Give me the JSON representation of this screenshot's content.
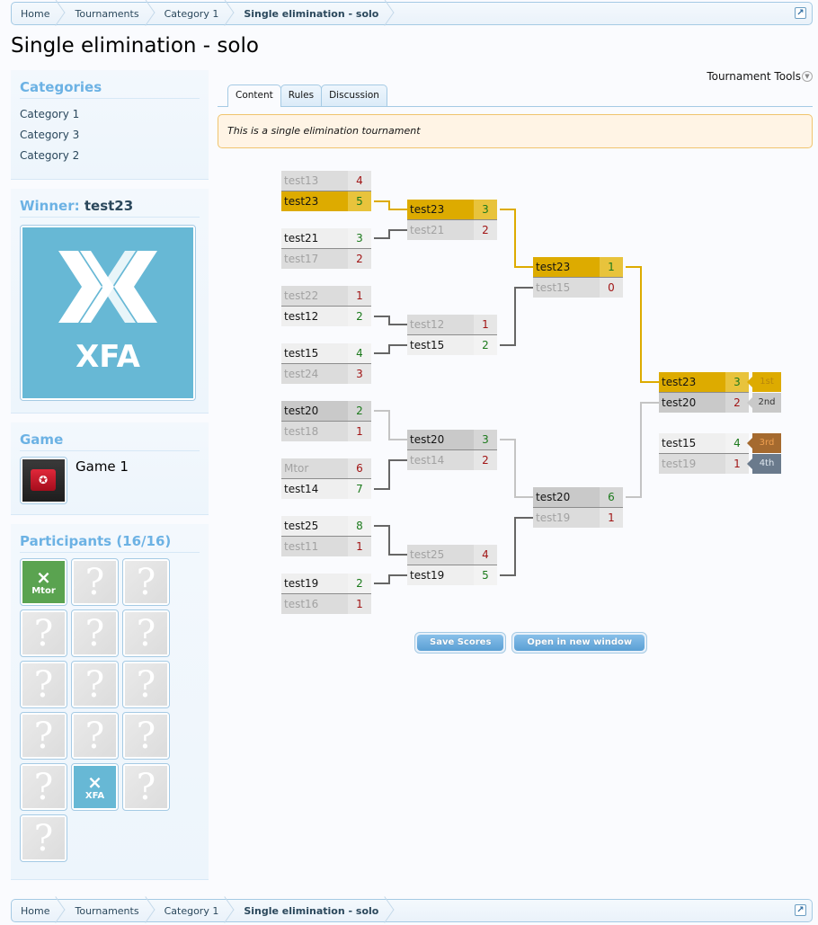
{
  "breadcrumb": {
    "items": [
      "Home",
      "Tournaments",
      "Category 1",
      "Single elimination - solo"
    ],
    "jump_icon": "arrow-up-right-icon"
  },
  "page": {
    "title": "Single elimination - solo"
  },
  "sidebar": {
    "categories": {
      "heading": "Categories",
      "items": [
        "Category 1",
        "Category 3",
        "Category 2"
      ]
    },
    "winner": {
      "label": "Winner:",
      "name": "test23",
      "logo_text": "XFA"
    },
    "game": {
      "heading": "Game",
      "name": "Game 1"
    },
    "participants": {
      "heading": "Participants (16/16)",
      "items": [
        {
          "label": "Mtor",
          "type": "team-green"
        },
        {
          "label": "",
          "type": "unknown"
        },
        {
          "label": "",
          "type": "unknown"
        },
        {
          "label": "",
          "type": "unknown"
        },
        {
          "label": "",
          "type": "unknown"
        },
        {
          "label": "",
          "type": "unknown"
        },
        {
          "label": "",
          "type": "unknown"
        },
        {
          "label": "",
          "type": "unknown"
        },
        {
          "label": "",
          "type": "unknown"
        },
        {
          "label": "",
          "type": "unknown"
        },
        {
          "label": "",
          "type": "unknown"
        },
        {
          "label": "",
          "type": "unknown"
        },
        {
          "label": "",
          "type": "unknown"
        },
        {
          "label": "XFA",
          "type": "team-blue"
        },
        {
          "label": "",
          "type": "unknown"
        },
        {
          "label": "",
          "type": "unknown"
        }
      ]
    }
  },
  "main": {
    "tools_label": "Tournament Tools",
    "tabs": [
      {
        "label": "Content",
        "active": true
      },
      {
        "label": "Rules",
        "active": false
      },
      {
        "label": "Discussion",
        "active": false
      }
    ],
    "description": "This is a single elimination tournament",
    "buttons": {
      "save": "Save Scores",
      "open": "Open in new window"
    }
  },
  "bracket": {
    "rounds": [
      [
        {
          "p1": {
            "name": "test13",
            "score": "4"
          },
          "p2": {
            "name": "test23",
            "score": "5"
          },
          "winner": 2
        },
        {
          "p1": {
            "name": "test21",
            "score": "3"
          },
          "p2": {
            "name": "test17",
            "score": "2"
          },
          "winner": 1
        },
        {
          "p1": {
            "name": "test22",
            "score": "1"
          },
          "p2": {
            "name": "test12",
            "score": "2"
          },
          "winner": 2
        },
        {
          "p1": {
            "name": "test15",
            "score": "4"
          },
          "p2": {
            "name": "test24",
            "score": "3"
          },
          "winner": 1
        },
        {
          "p1": {
            "name": "test20",
            "score": "2"
          },
          "p2": {
            "name": "test18",
            "score": "1"
          },
          "winner": 1
        },
        {
          "p1": {
            "name": "Mtor",
            "score": "6"
          },
          "p2": {
            "name": "test14",
            "score": "7"
          },
          "winner": 2
        },
        {
          "p1": {
            "name": "test25",
            "score": "8"
          },
          "p2": {
            "name": "test11",
            "score": "1"
          },
          "winner": 1
        },
        {
          "p1": {
            "name": "test19",
            "score": "2"
          },
          "p2": {
            "name": "test16",
            "score": "1"
          },
          "winner": 1
        }
      ],
      [
        {
          "p1": {
            "name": "test23",
            "score": "3"
          },
          "p2": {
            "name": "test21",
            "score": "2"
          },
          "winner": 1
        },
        {
          "p1": {
            "name": "test12",
            "score": "1"
          },
          "p2": {
            "name": "test15",
            "score": "2"
          },
          "winner": 2
        },
        {
          "p1": {
            "name": "test20",
            "score": "3"
          },
          "p2": {
            "name": "test14",
            "score": "2"
          },
          "winner": 1
        },
        {
          "p1": {
            "name": "test25",
            "score": "4"
          },
          "p2": {
            "name": "test19",
            "score": "5"
          },
          "winner": 2
        }
      ],
      [
        {
          "p1": {
            "name": "test23",
            "score": "1"
          },
          "p2": {
            "name": "test15",
            "score": "0"
          },
          "winner": 1
        },
        {
          "p1": {
            "name": "test20",
            "score": "6"
          },
          "p2": {
            "name": "test19",
            "score": "1"
          },
          "winner": 1
        }
      ],
      [
        {
          "p1": {
            "name": "test23",
            "score": "3"
          },
          "p2": {
            "name": "test20",
            "score": "2"
          },
          "winner": 1
        }
      ]
    ],
    "third_place": {
      "p1": {
        "name": "test15",
        "score": "4"
      },
      "p2": {
        "name": "test19",
        "score": "1"
      },
      "winner": 1
    },
    "places": [
      {
        "label": "1st",
        "bg": "#ddab00",
        "fg": "#b8860b"
      },
      {
        "label": "2nd",
        "bg": "#c9c9c9",
        "fg": "#333333"
      },
      {
        "label": "3rd",
        "bg": "#a56a2f",
        "fg": "#f0a050"
      },
      {
        "label": "4th",
        "bg": "#6a7a8c",
        "fg": "#e0e8f0"
      }
    ],
    "champion": "test23",
    "runner_up": "test20",
    "colors": {
      "champion_line": "#ddab00",
      "runner_line": "#c4c4c4",
      "default_line": "#666666"
    }
  }
}
